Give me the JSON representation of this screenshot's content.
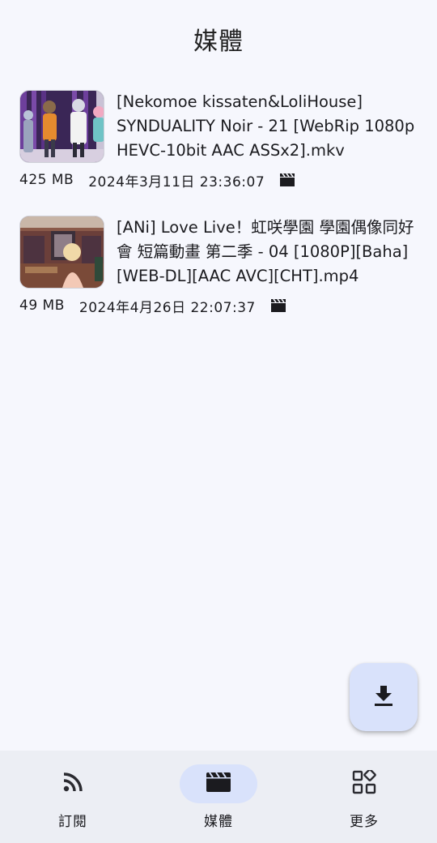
{
  "app_bar": {
    "title": "媒體"
  },
  "media_items": [
    {
      "title": "[Nekomoe kissaten&LoliHouse] SYNDUALITY Noir - 21 [WebRip 1080p HEVC-10bit AAC ASSx2].mkv",
      "size": "425 MB",
      "date": "2024年3月11日 23:36:07",
      "type_icon": "video-icon"
    },
    {
      "title": "[ANi] Love Live！虹咲學園 學園偶像同好會 短篇動畫 第二季 - 04 [1080P][Baha][WEB-DL][AAC AVC][CHT].mp4",
      "size": "49 MB",
      "date": "2024年4月26日 22:07:37",
      "type_icon": "video-icon"
    }
  ],
  "fab": {
    "icon": "download-icon"
  },
  "bottom_nav": {
    "items": [
      {
        "label": "訂閱",
        "icon": "rss-icon",
        "active": false
      },
      {
        "label": "媒體",
        "icon": "movie-icon",
        "active": true
      },
      {
        "label": "更多",
        "icon": "apps-icon",
        "active": false
      }
    ]
  },
  "colors": {
    "background": "#f6f7fd",
    "accent_container": "#d9e2fb",
    "nav_background": "#eceef4",
    "on_surface": "#1b1b1f"
  }
}
